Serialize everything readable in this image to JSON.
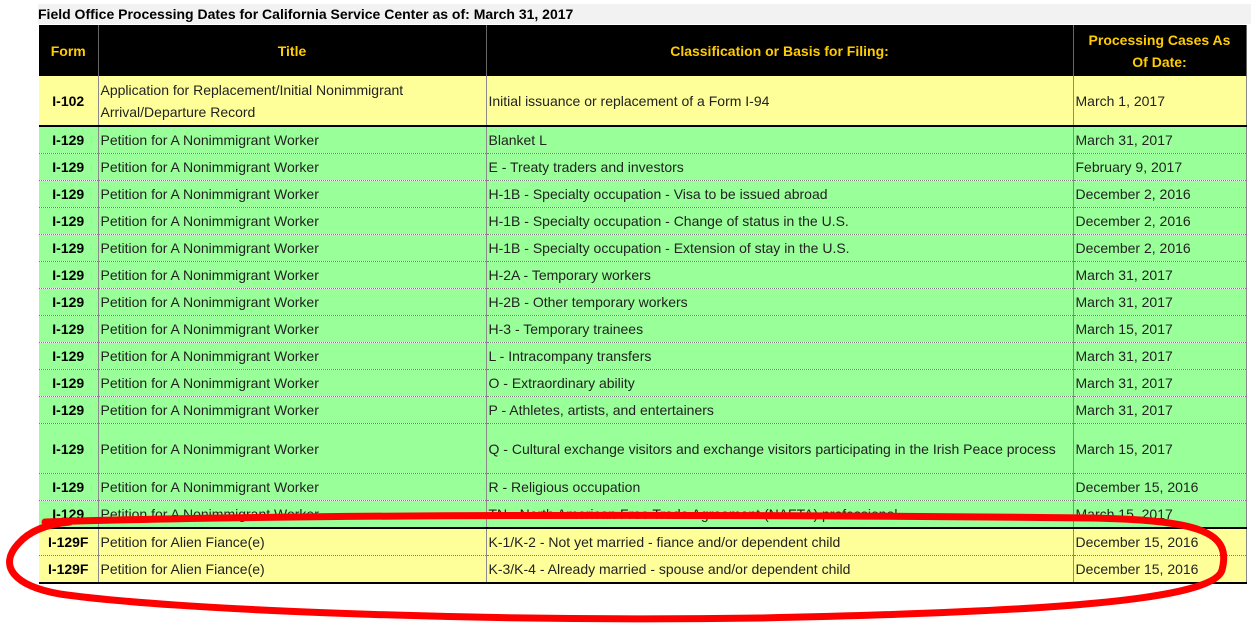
{
  "caption": "Field Office Processing Dates for California Service Center as of: March 31, 2017",
  "headers": {
    "form": "Form",
    "title": "Title",
    "classification": "Classification or Basis for Filing:",
    "date_line1": "Processing Cases As",
    "date_line2": "Of Date:"
  },
  "rows": [
    {
      "form": "I-102",
      "title": "Application for Replacement/Initial Nonimmigrant Arrival/Departure Record",
      "classification": "Initial issuance or replacement of a Form I-94",
      "date": "March 1, 2017"
    },
    {
      "form": "I-129",
      "title": "Petition for A Nonimmigrant Worker",
      "classification": "Blanket L",
      "date": "March 31, 2017"
    },
    {
      "form": "I-129",
      "title": "Petition for A Nonimmigrant Worker",
      "classification": "E - Treaty traders and investors",
      "date": "February 9, 2017"
    },
    {
      "form": "I-129",
      "title": "Petition for A Nonimmigrant Worker",
      "classification": "H-1B - Specialty occupation - Visa to be issued abroad",
      "date": "December 2, 2016"
    },
    {
      "form": "I-129",
      "title": "Petition for A Nonimmigrant Worker",
      "classification": "H-1B - Specialty occupation - Change of status in the U.S.",
      "date": "December 2, 2016"
    },
    {
      "form": "I-129",
      "title": "Petition for A Nonimmigrant Worker",
      "classification": "H-1B - Specialty occupation - Extension of stay in the U.S.",
      "date": "December 2, 2016"
    },
    {
      "form": "I-129",
      "title": "Petition for A Nonimmigrant Worker",
      "classification": "H-2A - Temporary workers",
      "date": "March 31, 2017"
    },
    {
      "form": "I-129",
      "title": "Petition for A Nonimmigrant Worker",
      "classification": "H-2B - Other temporary workers",
      "date": "March 31, 2017"
    },
    {
      "form": "I-129",
      "title": "Petition for A Nonimmigrant Worker",
      "classification": "H-3 - Temporary trainees",
      "date": "March 15, 2017"
    },
    {
      "form": "I-129",
      "title": "Petition for A Nonimmigrant Worker",
      "classification": "L - Intracompany transfers",
      "date": "March 31, 2017"
    },
    {
      "form": "I-129",
      "title": "Petition for A Nonimmigrant Worker",
      "classification": "O - Extraordinary ability",
      "date": "March 31, 2017"
    },
    {
      "form": "I-129",
      "title": "Petition for A Nonimmigrant Worker",
      "classification": "P - Athletes, artists, and entertainers",
      "date": "March 31, 2017"
    },
    {
      "form": "I-129",
      "title": "Petition for A Nonimmigrant Worker",
      "classification": "Q - Cultural exchange visitors and exchange visitors participating in the Irish Peace process",
      "date": "March 15, 2017"
    },
    {
      "form": "I-129",
      "title": "Petition for A Nonimmigrant Worker",
      "classification": "R - Religious occupation",
      "date": "December 15, 2016"
    },
    {
      "form": "I-129",
      "title": "Petition for A Nonimmigrant Worker",
      "classification": "TN - North American Free Trade Agreement (NAFTA) professional",
      "date": "March 15, 2017"
    },
    {
      "form": "I-129F",
      "title": "Petition for Alien Fiance(e)",
      "classification": "K-1/K-2 - Not yet married - fiance and/or dependent child",
      "date": "December 15, 2016"
    },
    {
      "form": "I-129F",
      "title": "Petition for Alien Fiance(e)",
      "classification": "K-3/K-4 - Already married - spouse and/or dependent child",
      "date": "December 15, 2016"
    }
  ],
  "colors": {
    "header_bg": "#000000",
    "header_text": "#ffcc00",
    "row_yellow": "#ffff99",
    "row_green": "#99ff99",
    "annotation": "#ff0000"
  }
}
